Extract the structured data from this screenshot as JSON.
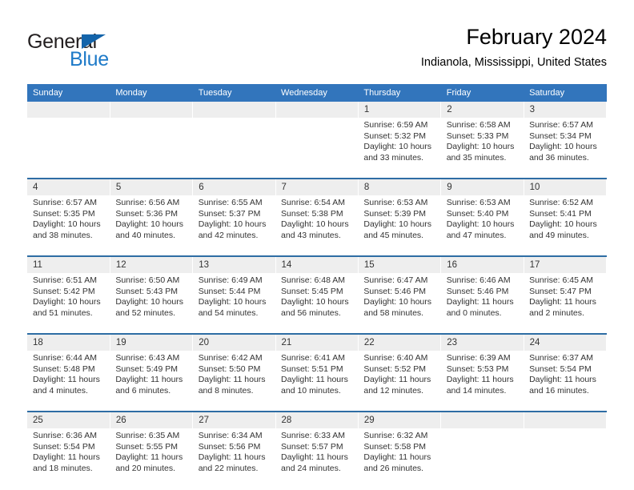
{
  "brand": {
    "name_part1": "General",
    "name_part2": "Blue"
  },
  "header": {
    "title": "February 2024",
    "location": "Indianola, Mississippi, United States"
  },
  "calendar": {
    "weekday_headers": [
      "Sunday",
      "Monday",
      "Tuesday",
      "Wednesday",
      "Thursday",
      "Friday",
      "Saturday"
    ],
    "colors": {
      "header_blue": "#3275bc",
      "row_divider_blue": "#2e6da4",
      "date_band_gray": "#eeeeee",
      "brand_blue": "#1e7ac8",
      "logo_flag_blue": "#1464aa"
    },
    "weeks": [
      {
        "days": [
          {
            "date": "",
            "lines": []
          },
          {
            "date": "",
            "lines": []
          },
          {
            "date": "",
            "lines": []
          },
          {
            "date": "",
            "lines": []
          },
          {
            "date": "1",
            "lines": [
              "Sunrise: 6:59 AM",
              "Sunset: 5:32 PM",
              "Daylight: 10 hours",
              "and 33 minutes."
            ]
          },
          {
            "date": "2",
            "lines": [
              "Sunrise: 6:58 AM",
              "Sunset: 5:33 PM",
              "Daylight: 10 hours",
              "and 35 minutes."
            ]
          },
          {
            "date": "3",
            "lines": [
              "Sunrise: 6:57 AM",
              "Sunset: 5:34 PM",
              "Daylight: 10 hours",
              "and 36 minutes."
            ]
          }
        ]
      },
      {
        "days": [
          {
            "date": "4",
            "lines": [
              "Sunrise: 6:57 AM",
              "Sunset: 5:35 PM",
              "Daylight: 10 hours",
              "and 38 minutes."
            ]
          },
          {
            "date": "5",
            "lines": [
              "Sunrise: 6:56 AM",
              "Sunset: 5:36 PM",
              "Daylight: 10 hours",
              "and 40 minutes."
            ]
          },
          {
            "date": "6",
            "lines": [
              "Sunrise: 6:55 AM",
              "Sunset: 5:37 PM",
              "Daylight: 10 hours",
              "and 42 minutes."
            ]
          },
          {
            "date": "7",
            "lines": [
              "Sunrise: 6:54 AM",
              "Sunset: 5:38 PM",
              "Daylight: 10 hours",
              "and 43 minutes."
            ]
          },
          {
            "date": "8",
            "lines": [
              "Sunrise: 6:53 AM",
              "Sunset: 5:39 PM",
              "Daylight: 10 hours",
              "and 45 minutes."
            ]
          },
          {
            "date": "9",
            "lines": [
              "Sunrise: 6:53 AM",
              "Sunset: 5:40 PM",
              "Daylight: 10 hours",
              "and 47 minutes."
            ]
          },
          {
            "date": "10",
            "lines": [
              "Sunrise: 6:52 AM",
              "Sunset: 5:41 PM",
              "Daylight: 10 hours",
              "and 49 minutes."
            ]
          }
        ]
      },
      {
        "days": [
          {
            "date": "11",
            "lines": [
              "Sunrise: 6:51 AM",
              "Sunset: 5:42 PM",
              "Daylight: 10 hours",
              "and 51 minutes."
            ]
          },
          {
            "date": "12",
            "lines": [
              "Sunrise: 6:50 AM",
              "Sunset: 5:43 PM",
              "Daylight: 10 hours",
              "and 52 minutes."
            ]
          },
          {
            "date": "13",
            "lines": [
              "Sunrise: 6:49 AM",
              "Sunset: 5:44 PM",
              "Daylight: 10 hours",
              "and 54 minutes."
            ]
          },
          {
            "date": "14",
            "lines": [
              "Sunrise: 6:48 AM",
              "Sunset: 5:45 PM",
              "Daylight: 10 hours",
              "and 56 minutes."
            ]
          },
          {
            "date": "15",
            "lines": [
              "Sunrise: 6:47 AM",
              "Sunset: 5:46 PM",
              "Daylight: 10 hours",
              "and 58 minutes."
            ]
          },
          {
            "date": "16",
            "lines": [
              "Sunrise: 6:46 AM",
              "Sunset: 5:46 PM",
              "Daylight: 11 hours",
              "and 0 minutes."
            ]
          },
          {
            "date": "17",
            "lines": [
              "Sunrise: 6:45 AM",
              "Sunset: 5:47 PM",
              "Daylight: 11 hours",
              "and 2 minutes."
            ]
          }
        ]
      },
      {
        "days": [
          {
            "date": "18",
            "lines": [
              "Sunrise: 6:44 AM",
              "Sunset: 5:48 PM",
              "Daylight: 11 hours",
              "and 4 minutes."
            ]
          },
          {
            "date": "19",
            "lines": [
              "Sunrise: 6:43 AM",
              "Sunset: 5:49 PM",
              "Daylight: 11 hours",
              "and 6 minutes."
            ]
          },
          {
            "date": "20",
            "lines": [
              "Sunrise: 6:42 AM",
              "Sunset: 5:50 PM",
              "Daylight: 11 hours",
              "and 8 minutes."
            ]
          },
          {
            "date": "21",
            "lines": [
              "Sunrise: 6:41 AM",
              "Sunset: 5:51 PM",
              "Daylight: 11 hours",
              "and 10 minutes."
            ]
          },
          {
            "date": "22",
            "lines": [
              "Sunrise: 6:40 AM",
              "Sunset: 5:52 PM",
              "Daylight: 11 hours",
              "and 12 minutes."
            ]
          },
          {
            "date": "23",
            "lines": [
              "Sunrise: 6:39 AM",
              "Sunset: 5:53 PM",
              "Daylight: 11 hours",
              "and 14 minutes."
            ]
          },
          {
            "date": "24",
            "lines": [
              "Sunrise: 6:37 AM",
              "Sunset: 5:54 PM",
              "Daylight: 11 hours",
              "and 16 minutes."
            ]
          }
        ]
      },
      {
        "days": [
          {
            "date": "25",
            "lines": [
              "Sunrise: 6:36 AM",
              "Sunset: 5:54 PM",
              "Daylight: 11 hours",
              "and 18 minutes."
            ]
          },
          {
            "date": "26",
            "lines": [
              "Sunrise: 6:35 AM",
              "Sunset: 5:55 PM",
              "Daylight: 11 hours",
              "and 20 minutes."
            ]
          },
          {
            "date": "27",
            "lines": [
              "Sunrise: 6:34 AM",
              "Sunset: 5:56 PM",
              "Daylight: 11 hours",
              "and 22 minutes."
            ]
          },
          {
            "date": "28",
            "lines": [
              "Sunrise: 6:33 AM",
              "Sunset: 5:57 PM",
              "Daylight: 11 hours",
              "and 24 minutes."
            ]
          },
          {
            "date": "29",
            "lines": [
              "Sunrise: 6:32 AM",
              "Sunset: 5:58 PM",
              "Daylight: 11 hours",
              "and 26 minutes."
            ]
          },
          {
            "date": "",
            "lines": []
          },
          {
            "date": "",
            "lines": []
          }
        ]
      }
    ]
  }
}
